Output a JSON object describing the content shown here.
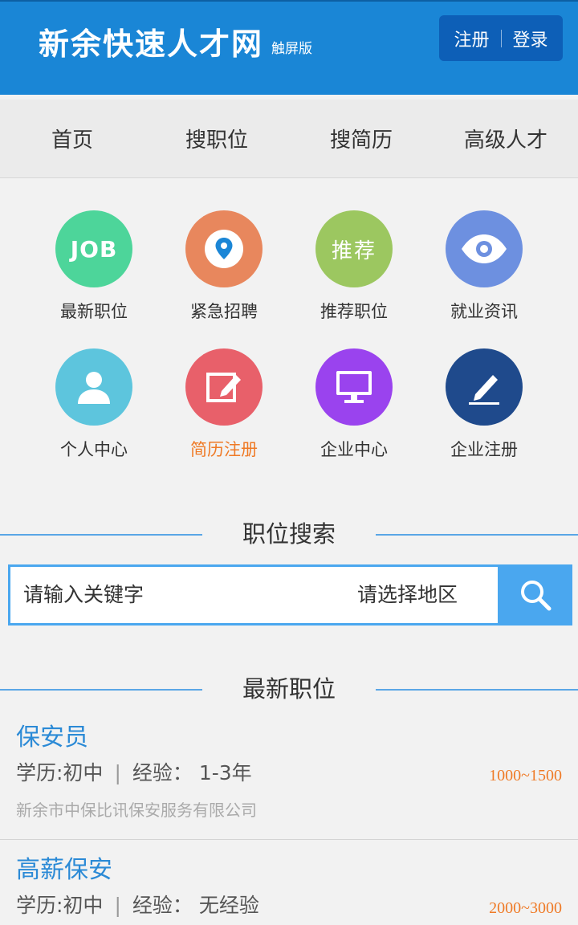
{
  "header": {
    "title": "新余快速人才网",
    "subtitle": "触屏版",
    "register": "注册",
    "login": "登录"
  },
  "nav": [
    "首页",
    "搜职位",
    "搜简历",
    "高级人才"
  ],
  "grid": [
    {
      "label": "最新职位",
      "icon": "job-icon",
      "icon_text": "JOB",
      "color": "#4dd59a"
    },
    {
      "label": "紧急招聘",
      "icon": "location-pin-icon",
      "color": "#e8875d"
    },
    {
      "label": "推荐职位",
      "icon": "recommend-icon",
      "icon_text": "推荐",
      "color": "#9cc760"
    },
    {
      "label": "就业资讯",
      "icon": "eye-icon",
      "color": "#6d90e0"
    },
    {
      "label": "个人中心",
      "icon": "user-icon",
      "color": "#5dc5dd"
    },
    {
      "label": "简历注册",
      "icon": "edit-icon",
      "color": "#e8606a",
      "highlight": true
    },
    {
      "label": "企业中心",
      "icon": "monitor-icon",
      "color": "#9a43ee"
    },
    {
      "label": "企业注册",
      "icon": "pen-icon",
      "color": "#1f4a8c"
    }
  ],
  "search_section": {
    "title": "职位搜索",
    "keyword_placeholder": "请输入关键字",
    "area_placeholder": "请选择地区"
  },
  "latest_section": {
    "title": "最新职位"
  },
  "jobs": [
    {
      "title": "保安员",
      "edu": "学历:初中",
      "exp": "经验： 1-3年",
      "salary": "1000~1500",
      "company": "新余市中保比讯保安服务有限公司"
    },
    {
      "title": "高薪保安",
      "edu": "学历:初中",
      "exp": "经验： 无经验",
      "salary": "2000~3000",
      "company": ""
    }
  ],
  "colors": {
    "header_bg": "#1a86d6",
    "accent": "#4aa7ef",
    "salary": "#ef7a26"
  }
}
